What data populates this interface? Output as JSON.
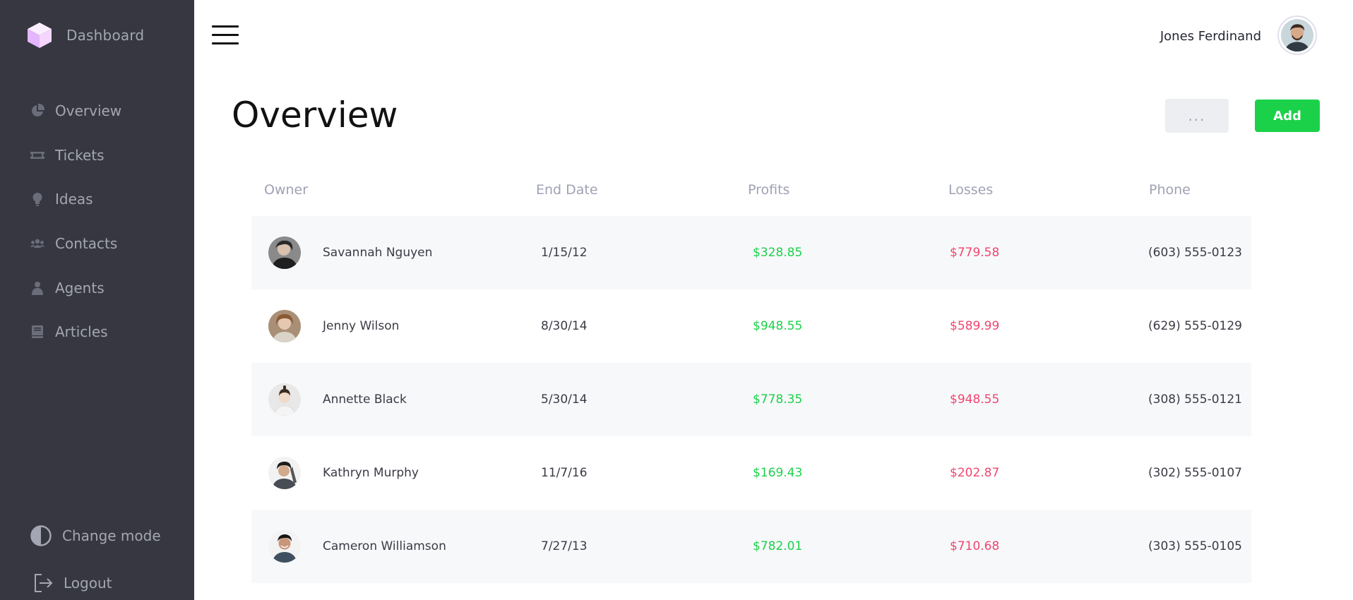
{
  "app": {
    "brand_label": "Dashboard"
  },
  "sidebar": {
    "items": [
      {
        "label": "Overview",
        "icon": "pie-chart-icon"
      },
      {
        "label": "Tickets",
        "icon": "ticket-icon"
      },
      {
        "label": "Ideas",
        "icon": "lightbulb-icon"
      },
      {
        "label": "Contacts",
        "icon": "users-icon"
      },
      {
        "label": "Agents",
        "icon": "agent-icon"
      },
      {
        "label": "Articles",
        "icon": "book-icon"
      }
    ],
    "change_mode_label": "Change mode",
    "logout_label": "Logout"
  },
  "header": {
    "user_name": "Jones Ferdinand"
  },
  "main": {
    "title": "Overview",
    "more_label": "...",
    "add_label": "Add"
  },
  "table": {
    "columns": [
      "Owner",
      "End Date",
      "Profits",
      "Losses",
      "Phone"
    ],
    "rows": [
      {
        "owner": "Savannah Nguyen",
        "end_date": "1/15/12",
        "profits": "$328.85",
        "losses": "$779.58",
        "phone": "(603) 555-0123"
      },
      {
        "owner": "Jenny Wilson",
        "end_date": "8/30/14",
        "profits": "$948.55",
        "losses": "$589.99",
        "phone": "(629) 555-0129"
      },
      {
        "owner": "Annette Black",
        "end_date": "5/30/14",
        "profits": "$778.35",
        "losses": "$948.55",
        "phone": "(308) 555-0121"
      },
      {
        "owner": "Kathryn Murphy",
        "end_date": "11/7/16",
        "profits": "$169.43",
        "losses": "$202.87",
        "phone": "(302) 555-0107"
      },
      {
        "owner": "Cameron Williamson",
        "end_date": "7/27/13",
        "profits": "$782.01",
        "losses": "$710.68",
        "phone": "(303) 555-0105"
      }
    ]
  },
  "colors": {
    "sidebar_bg": "#363740",
    "accent_green": "#1cd14a",
    "loss_pink": "#f0466f",
    "muted_text": "#9fa2b4",
    "brand_cube": "#dde2ff"
  }
}
